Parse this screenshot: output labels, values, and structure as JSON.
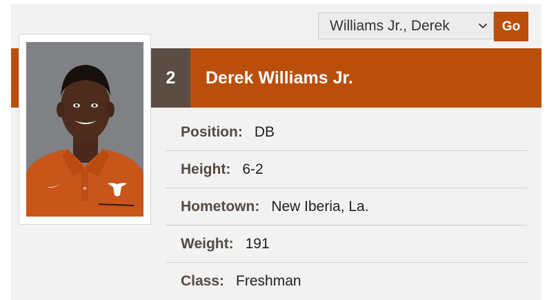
{
  "player_picker": {
    "selected": "Williams Jr., Derek",
    "go_label": "Go"
  },
  "player": {
    "number": "2",
    "name": "Derek Williams Jr."
  },
  "bio": [
    {
      "label": "Position:",
      "value": "DB"
    },
    {
      "label": "Height:",
      "value": "6-2"
    },
    {
      "label": "Hometown:",
      "value": "New Iberia, La."
    },
    {
      "label": "Weight:",
      "value": "191"
    },
    {
      "label": "Class:",
      "value": "Freshman"
    }
  ],
  "colors": {
    "burnt_orange": "#b94f0b",
    "number_box": "#5b4c44",
    "panel_background": "#f2f2f2"
  }
}
